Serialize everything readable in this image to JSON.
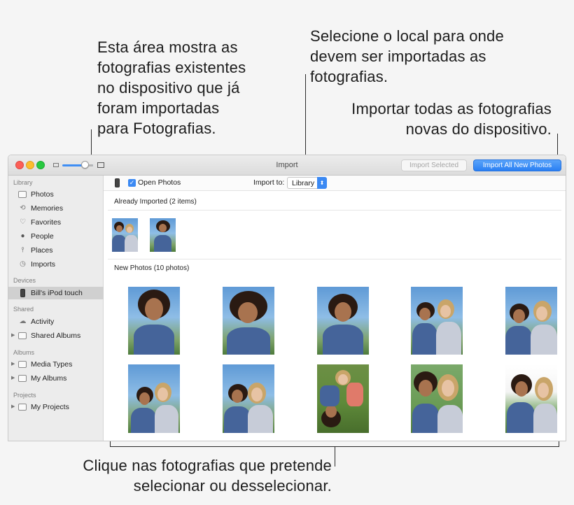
{
  "callouts": {
    "imported_area": [
      "Esta área mostra as",
      "fotografias existentes",
      "no dispositivo que já",
      "foram importadas",
      "para Fotografias."
    ],
    "select_location": [
      "Selecione o local para onde",
      "devem ser importadas as",
      "fotografias."
    ],
    "import_all": [
      "Importar todas as fotografias",
      "novas do dispositivo."
    ],
    "click_photos": [
      "Clique nas fotografias que pretende",
      "selecionar ou desselecionar."
    ]
  },
  "window": {
    "title": "Import",
    "import_selected_label": "Import Selected",
    "import_all_label": "Import All New Photos"
  },
  "sidebar": {
    "library_header": "Library",
    "library_items": [
      {
        "label": "Photos",
        "icon": "photos-icon"
      },
      {
        "label": "Memories",
        "icon": "memories-icon"
      },
      {
        "label": "Favorites",
        "icon": "heart-icon"
      },
      {
        "label": "People",
        "icon": "person-icon"
      },
      {
        "label": "Places",
        "icon": "pin-icon"
      },
      {
        "label": "Imports",
        "icon": "clock-icon"
      }
    ],
    "devices_header": "Devices",
    "device_item": "Bill's iPod touch",
    "shared_header": "Shared",
    "shared_items": [
      {
        "label": "Activity",
        "icon": "cloud-icon"
      },
      {
        "label": "Shared Albums",
        "icon": "folder-icon"
      }
    ],
    "albums_header": "Albums",
    "album_items": [
      {
        "label": "Media Types",
        "icon": "folder-icon"
      },
      {
        "label": "My Albums",
        "icon": "folder-icon"
      }
    ],
    "projects_header": "Projects",
    "project_items": [
      {
        "label": "My Projects",
        "icon": "folder-icon"
      }
    ]
  },
  "main": {
    "open_photos_label": "Open Photos",
    "open_photos_checked": true,
    "import_to_label": "Import to:",
    "import_to_value": "Library",
    "already_imported_header": "Already Imported (2 items)",
    "new_photos_header": "New Photos (10 photos)"
  },
  "colors": {
    "accent": "#3b89f3",
    "close": "#fc5f57",
    "minimize": "#fdbd2e",
    "zoom": "#28c940"
  }
}
